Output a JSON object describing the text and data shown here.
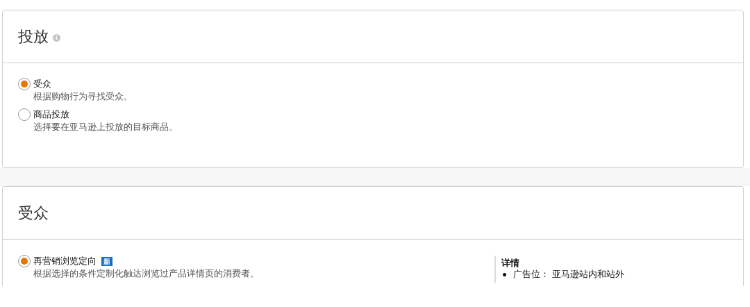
{
  "targeting_card": {
    "title": "投放",
    "options": [
      {
        "label": "受众",
        "description": "根据购物行为寻找受众。",
        "selected": true
      },
      {
        "label": "商品投放",
        "description": "选择要在亚马逊上投放的目标商品。",
        "selected": false
      }
    ]
  },
  "audience_card": {
    "title": "受众",
    "options": [
      {
        "label": "再营销浏览定向",
        "badge": "新",
        "description": "根据选择的条件定制化触达浏览过产品详情页的消费者。",
        "selected": true
      }
    ],
    "details": {
      "heading": "详情",
      "items": [
        "广告位： 亚马逊站内和站外"
      ]
    }
  }
}
